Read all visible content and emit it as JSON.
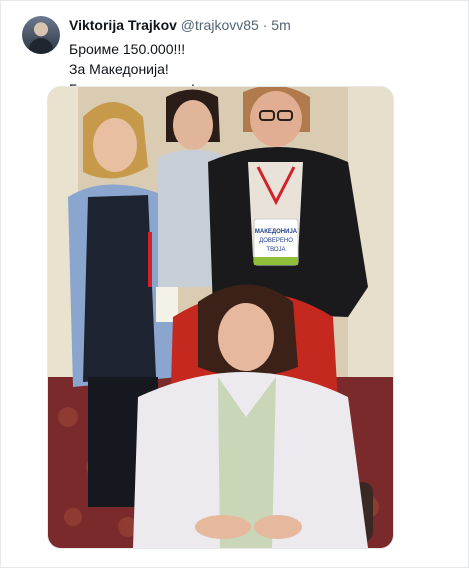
{
  "tweet": {
    "author_name": "Viktorija Trajkov",
    "handle": "@trajkovv85",
    "separator": "·",
    "time": "5m",
    "lines": [
      "Броиме 150.000!!!",
      "За Македонија!",
      "Горда и исправена!"
    ]
  },
  "photo": {
    "badge_text": [
      "МАКЕДОНИЈА",
      "ДОВЕРЕНО",
      "ТВОЈА"
    ]
  },
  "colors": {
    "text": "#0f1419",
    "secondary_text": "#536471",
    "border": "#e6e8ea"
  }
}
